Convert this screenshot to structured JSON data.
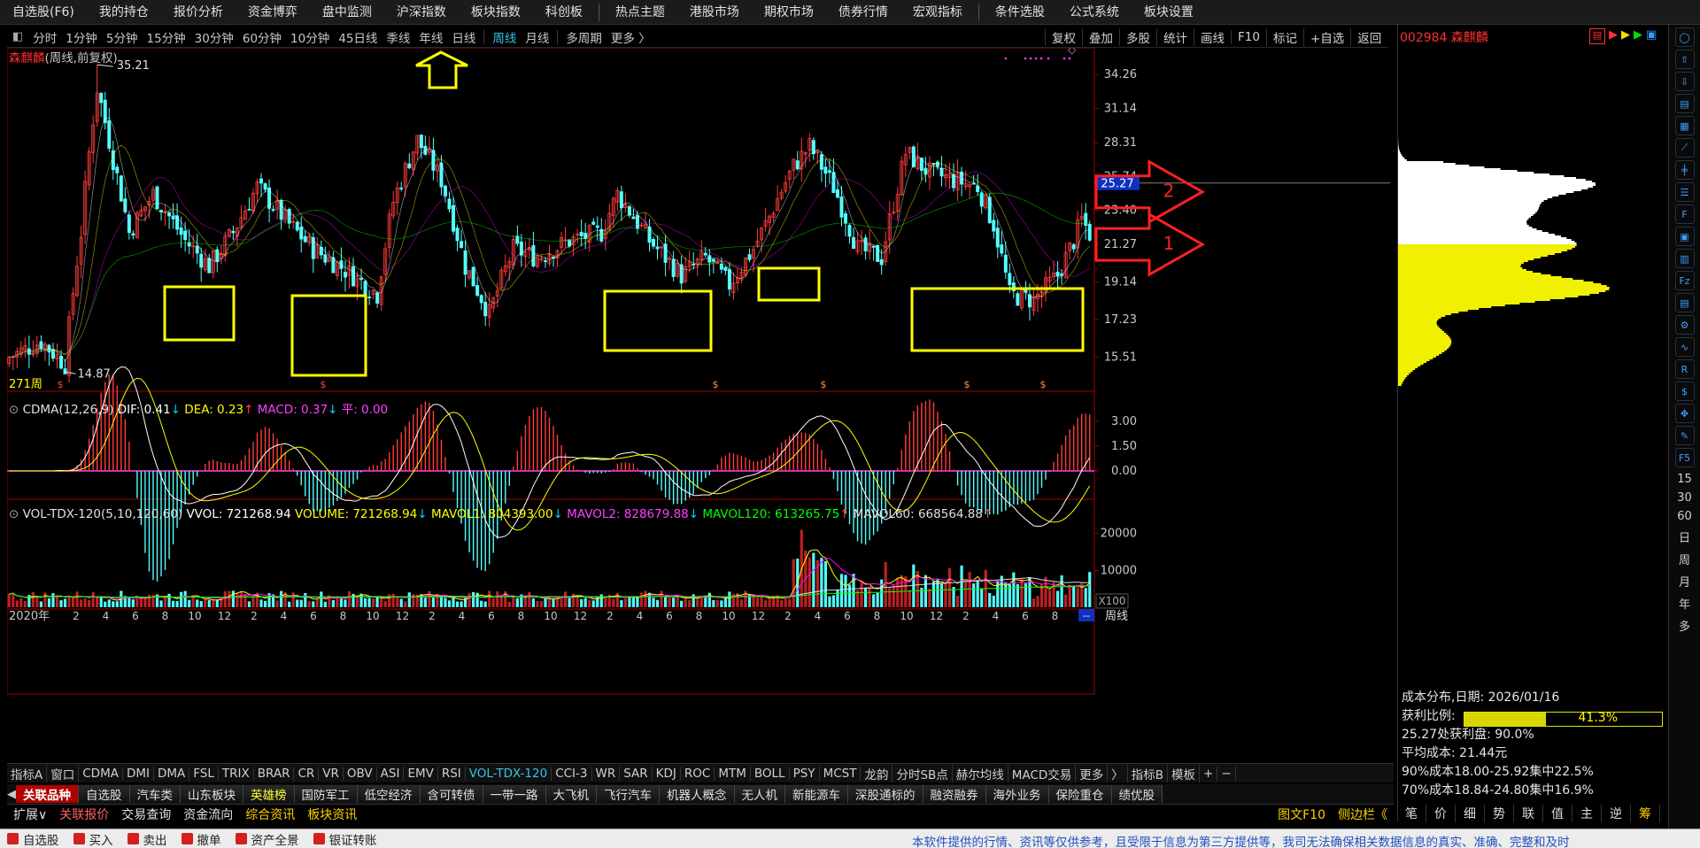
{
  "top_menu": [
    "自选股(F6)",
    "我的持仓",
    "报价分析",
    "资金博弈",
    "盘中监测",
    "沪深指数",
    "板块指数",
    "科创板",
    "热点主题",
    "港股市场",
    "期权市场",
    "债券行情",
    "宏观指标",
    "条件选股",
    "公式系统",
    "板块设置"
  ],
  "timeframes": {
    "items": [
      "分时",
      "1分钟",
      "5分钟",
      "15分钟",
      "30分钟",
      "60分钟",
      "10分钟",
      "45日线",
      "季线",
      "年线",
      "日线",
      "周线",
      "月线",
      "多周期",
      "更多 〉"
    ],
    "active": "周线"
  },
  "chart_tools": [
    "复权",
    "叠加",
    "多股",
    "统计",
    "画线",
    "F10",
    "标记",
    "+自选",
    "返回"
  ],
  "main_panel": {
    "title_name": "森麒麟",
    "title_suffix": "(周线,前复权)",
    "bars_label": "271周",
    "high_label": "35.21",
    "low_label": "14.87",
    "price_ticks": [
      "34.26",
      "31.14",
      "28.31",
      "25.74",
      "23.40",
      "21.27",
      "19.14",
      "17.23",
      "15.51"
    ],
    "current_price_tag": "25.27",
    "dollar_marker": "$",
    "annotation_numbers": [
      "2",
      "1"
    ]
  },
  "macd_panel": {
    "name": "CDMA(12,26,9)",
    "dif": "DIF: 0.41",
    "dea": "DEA: 0.23",
    "macd": "MACD: 0.37",
    "ping": "平: 0.00",
    "ticks": [
      "3.00",
      "1.50",
      "0.00"
    ],
    "dif_arrow": "↓",
    "dea_arrow": "↑",
    "macd_arrow": "↓"
  },
  "volume_panel": {
    "name": "VOL-TDX-120(5,10,120,60)",
    "vvol": "VVOL: 721268.94",
    "volume": "VOLUME: 721268.94",
    "mavol1": "MAVOL1: 804393.00",
    "mavol2": "MAVOL2: 828679.88",
    "mavol120": "MAVOL120: 613265.75",
    "mavol60": "MAVOL60: 668564.88",
    "ticks": [
      "20000",
      "10000"
    ],
    "unit": "X100",
    "arrows": [
      "↓",
      "↓",
      "↓",
      "↑",
      "↑"
    ]
  },
  "x_axis": {
    "year": "2020年",
    "months": [
      "2",
      "4",
      "6",
      "8",
      "10",
      "12",
      "2",
      "4",
      "6",
      "8",
      "10",
      "12",
      "2",
      "4",
      "6",
      "8",
      "10",
      "12",
      "2",
      "4",
      "6",
      "8",
      "10",
      "12",
      "2",
      "4",
      "6",
      "8",
      "10",
      "12",
      "2",
      "4",
      "6",
      "8",
      "10",
      "12"
    ],
    "period_label": "周线",
    "end_marker": "--"
  },
  "indicator_tabs": {
    "items": [
      "指标A",
      "窗口",
      "CDMA",
      "DMI",
      "DMA",
      "FSL",
      "TRIX",
      "BRAR",
      "CR",
      "VR",
      "OBV",
      "ASI",
      "EMV",
      "RSI",
      "VOL-TDX-120",
      "CCI-3",
      "WR",
      "SAR",
      "KDJ",
      "ROC",
      "MTM",
      "BOLL",
      "PSY",
      "MCST",
      "龙韵",
      "分时SB点",
      "赫尔均线",
      "MACD交易",
      "更多",
      "〉",
      "指标B",
      "模板",
      "+",
      "−"
    ],
    "active": "VOL-TDX-120"
  },
  "sector_tabs": {
    "items": [
      "关联品种",
      "自选股",
      "汽车类",
      "山东板块",
      "英雄榜",
      "国防军工",
      "低空经济",
      "含可转债",
      "一带一路",
      "大飞机",
      "飞行汽车",
      "机器人概念",
      "无人机",
      "新能源车",
      "深股通标的",
      "融资融券",
      "海外业务",
      "保险重仓",
      "绩优股"
    ],
    "highlight": "英雄榜"
  },
  "link_bar": [
    "扩展∨",
    "关联报价",
    "交易查询",
    "资金流向",
    "综合资讯",
    "板块资讯",
    "图文F10",
    "侧边栏《"
  ],
  "right_tabs": [
    "笔",
    "价",
    "细",
    "势",
    "联",
    "值",
    "主",
    "逆",
    "筹"
  ],
  "right_panel": {
    "stock_code": "002984 森麒麟",
    "cost_date": "成本分布,日期:  2026/01/16",
    "profit_label": "获利比例:",
    "profit_ratio": "41.3%",
    "profit_fraction": 0.413,
    "profit_at_price": "25.27处获利盘:  90.0%",
    "avg_cost": "平均成本:  21.44元",
    "cost90": "90%成本18.00-25.92集中22.5%",
    "cost70": "70%成本18.84-24.80集中16.9%"
  },
  "side_buttons_text": [
    "15",
    "30",
    "60",
    "日",
    "周",
    "月",
    "年",
    "多"
  ],
  "status_bar": {
    "items": [
      "自选股",
      "买入",
      "卖出",
      "撤单",
      "资产全景",
      "银证转账"
    ],
    "ticker": "本软件提供的行情、资讯等仅供参考，且受限于信息为第三方提供等，我司无法确保相关数据信息的真实、准确、完整和及时"
  },
  "colors": {
    "up": "#ff3c3c",
    "down": "#54ffff",
    "ma_white": "#ffffff",
    "ma_yellow": "#ffff00",
    "ma_magenta": "#ff00ff",
    "ma_green": "#00ff00",
    "box": "#ffff00",
    "grid": "#8b0000",
    "axis": "#a00000"
  }
}
